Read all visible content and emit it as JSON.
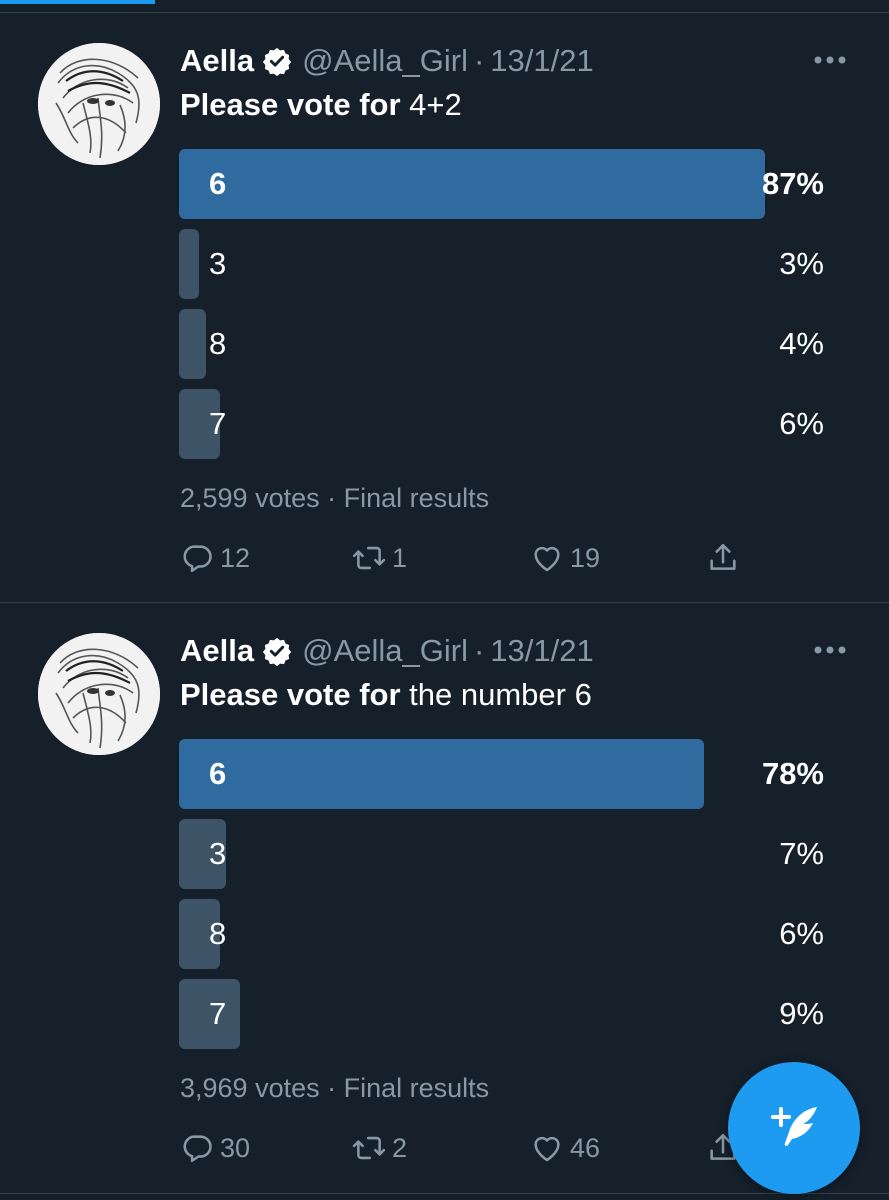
{
  "colors": {
    "background": "#15202b",
    "accent": "#1d9bf0",
    "winning_bar": "#2f6b9e",
    "other_bar": "#3d5466",
    "muted_text": "#8899a6"
  },
  "tweets": [
    {
      "name": "Aella",
      "handle": "@Aella_Girl",
      "dot": "·",
      "time": "13/1/21",
      "text_bold": "Please vote for",
      "text_rest": " 4+2",
      "poll": [
        {
          "label": "6",
          "percent": "87%",
          "fraction": 0.908,
          "winner": true
        },
        {
          "label": "3",
          "percent": "3%",
          "fraction": 0.031,
          "winner": false
        },
        {
          "label": "8",
          "percent": "4%",
          "fraction": 0.042,
          "winner": false
        },
        {
          "label": "7",
          "percent": "6%",
          "fraction": 0.063,
          "winner": false
        }
      ],
      "meta": "2,599 votes · Final results",
      "replies": "12",
      "retweets": "1",
      "likes": "19"
    },
    {
      "name": "Aella",
      "handle": "@Aella_Girl",
      "dot": "·",
      "time": "13/1/21",
      "text_bold": "Please vote for",
      "text_rest": " the number 6",
      "poll": [
        {
          "label": "6",
          "percent": "78%",
          "fraction": 0.814,
          "winner": true
        },
        {
          "label": "3",
          "percent": "7%",
          "fraction": 0.073,
          "winner": false
        },
        {
          "label": "8",
          "percent": "6%",
          "fraction": 0.063,
          "winner": false
        },
        {
          "label": "7",
          "percent": "9%",
          "fraction": 0.094,
          "winner": false
        }
      ],
      "meta": "3,969 votes · Final results",
      "replies": "30",
      "retweets": "2",
      "likes": "46"
    }
  ],
  "fab": {
    "icon": "compose-tweet-icon"
  }
}
